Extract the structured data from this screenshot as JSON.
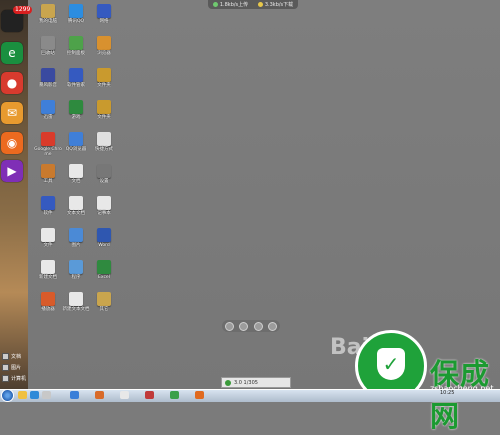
{
  "top_gadget": {
    "item1": "1.8kb/s上传",
    "item2": "3.3kb/s下载"
  },
  "dock": {
    "badge": "1299",
    "items": [
      {
        "name": "app-avatar",
        "color": "#222"
      },
      {
        "name": "ie-browser",
        "color": "#1a8f3f",
        "glyph": "e"
      },
      {
        "name": "red-app",
        "color": "#d83b2e",
        "glyph": "●"
      },
      {
        "name": "mail-app",
        "color": "#e89a2f",
        "glyph": "✉"
      },
      {
        "name": "game-app",
        "color": "#ec6a1f",
        "glyph": "◉"
      },
      {
        "name": "video-app",
        "color": "#7f2fb6",
        "glyph": "▶"
      }
    ]
  },
  "quicklinks": [
    "文档",
    "图片",
    "计算机"
  ],
  "desktop_icons": [
    {
      "label": "我的电脑",
      "color": "#c9a54e"
    },
    {
      "label": "腾讯QQ",
      "color": "#2c8de0"
    },
    {
      "label": "网络",
      "color": "#355ac0"
    },
    {
      "label": "回收站",
      "color": "#8a8a8a"
    },
    {
      "label": "控制面板",
      "color": "#4ea24a"
    },
    {
      "label": "浏览器",
      "color": "#d8912f"
    },
    {
      "label": "暴风影音",
      "color": "#3a4aa0"
    },
    {
      "label": "软件管家",
      "color": "#355ac0"
    },
    {
      "label": "文件夹",
      "color": "#c99a2e"
    },
    {
      "label": "迅雷",
      "color": "#3f7fd8"
    },
    {
      "label": "游戏",
      "color": "#2e8a3e"
    },
    {
      "label": "文件夹",
      "color": "#c99a2e"
    },
    {
      "label": "Google Chrome",
      "color": "#d93b2b"
    },
    {
      "label": "QQ浏览器",
      "color": "#3f7fd8"
    },
    {
      "label": "快捷方式",
      "color": "#e0e0e0"
    },
    {
      "label": "工具",
      "color": "#c97a2e"
    },
    {
      "label": "文档",
      "color": "#e8e8e8"
    },
    {
      "label": "设置",
      "color": "#777"
    },
    {
      "label": "软件",
      "color": "#355ac0"
    },
    {
      "label": "文本文档",
      "color": "#e8e8e8"
    },
    {
      "label": "记事本",
      "color": "#e8e8e8"
    },
    {
      "label": "文件",
      "color": "#e8e8e8"
    },
    {
      "label": "图片",
      "color": "#4b8ad6"
    },
    {
      "label": "Word",
      "color": "#2f57b0"
    },
    {
      "label": "新建文档",
      "color": "#e8e8e8"
    },
    {
      "label": "程序",
      "color": "#5a9ad8"
    },
    {
      "label": "Excel",
      "color": "#2f8a3f"
    },
    {
      "label": "播放器",
      "color": "#d85b2a"
    },
    {
      "label": "新建文本文档",
      "color": "#e8e8e8"
    },
    {
      "label": "其它",
      "color": "#c9a54e"
    }
  ],
  "toolbar": {
    "label": "3.0 1/305"
  },
  "watermark": {
    "brand": "保成网",
    "url": "zsbaocheng.net",
    "baidu": "Bai"
  },
  "taskbar": {
    "time": "10:25"
  }
}
